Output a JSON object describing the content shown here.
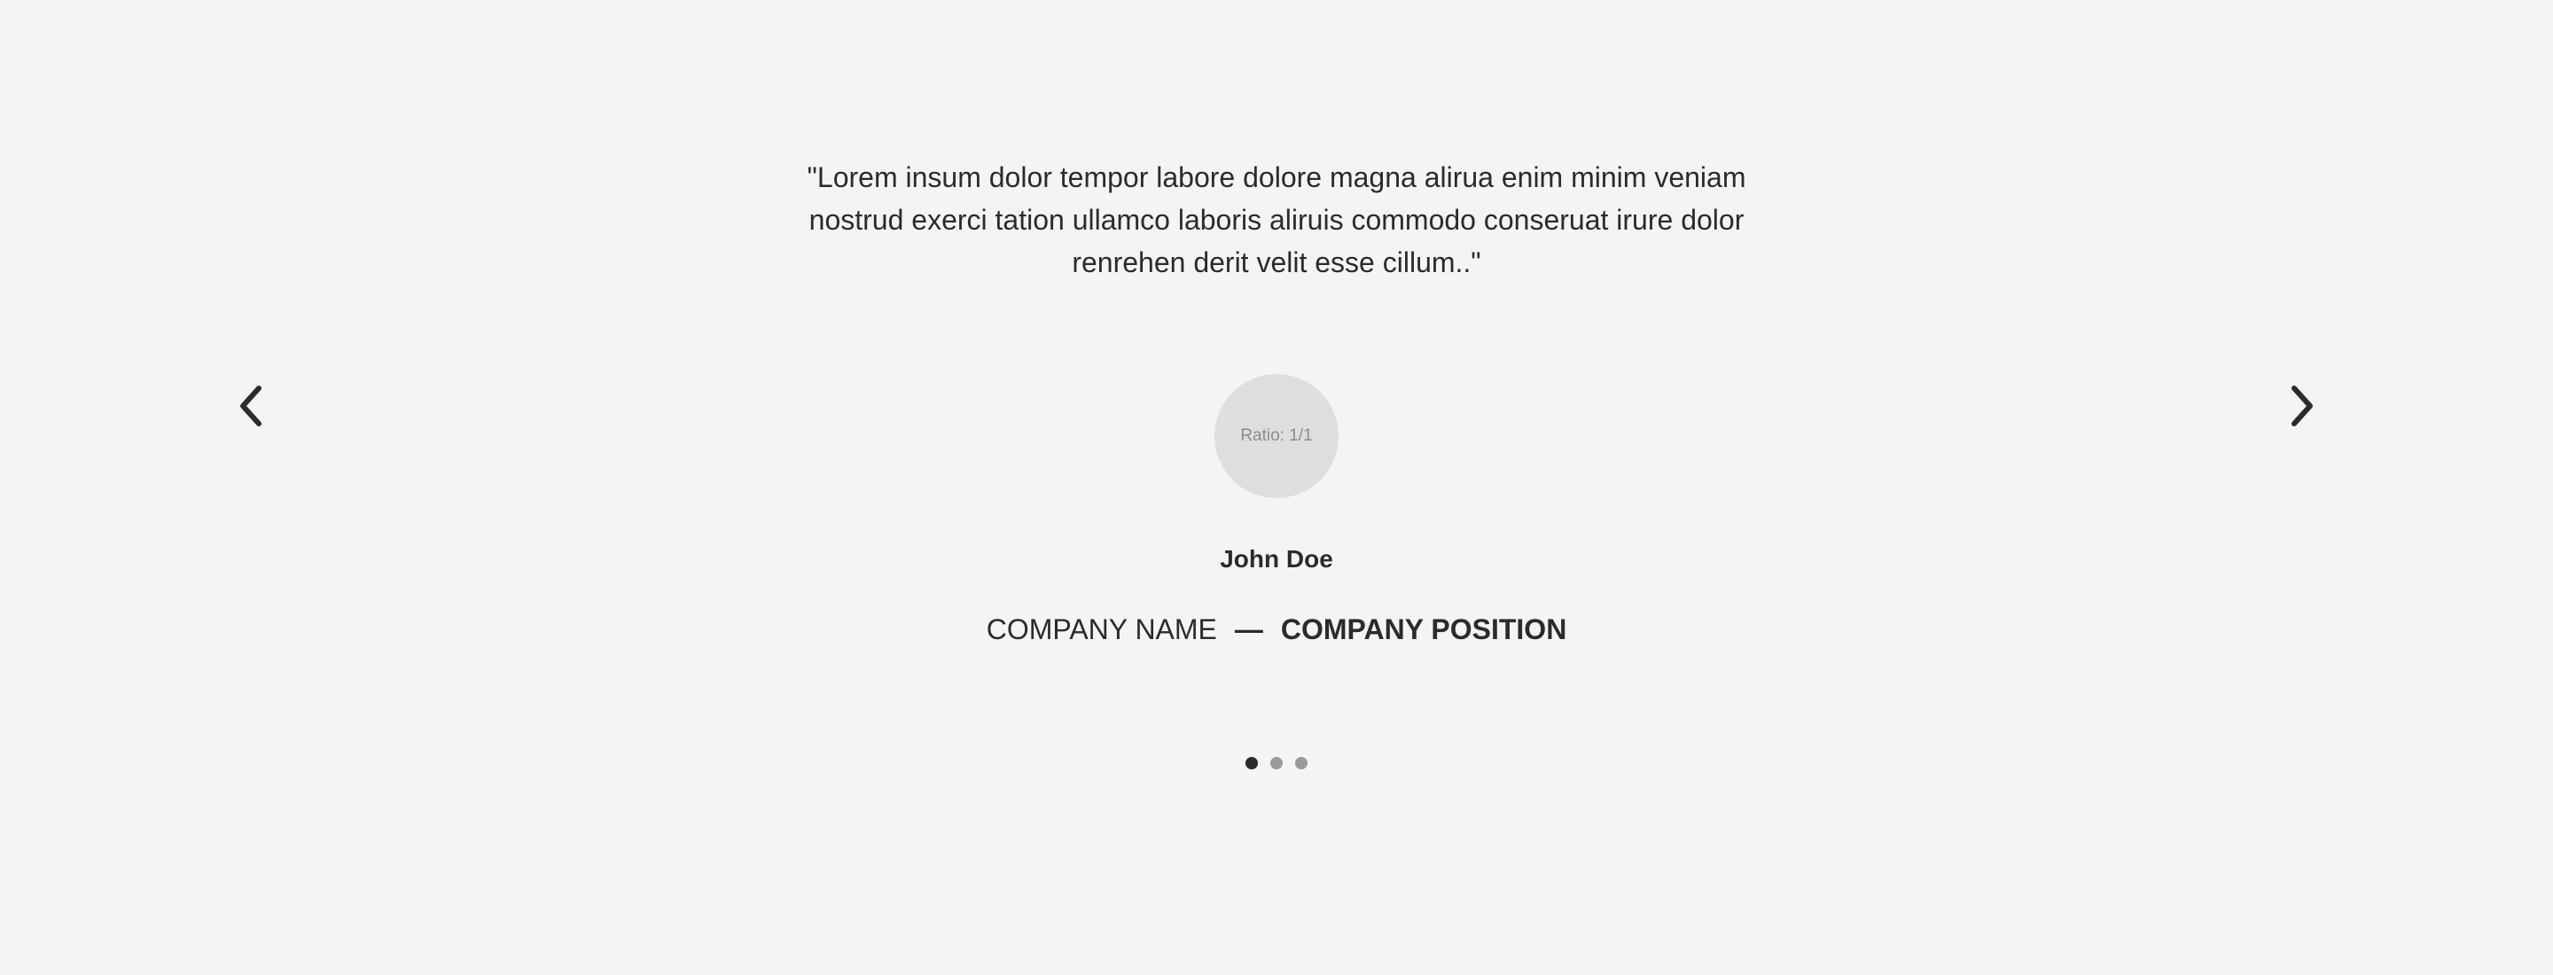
{
  "testimonial": {
    "quote": "\"Lorem insum dolor tempor labore dolore magna alirua enim minim veniam nostrud exerci tation ullamco laboris aliruis commodo conseruat irure dolor renrehen derit velit esse cillum..\"",
    "avatar_placeholder": "Ratio: 1/1",
    "name": "John Doe",
    "company_name": "COMPANY NAME",
    "separator": "—",
    "company_position": "COMPANY POSITION"
  },
  "navigation": {
    "prev_icon": "chevron-left-icon",
    "next_icon": "chevron-right-icon"
  },
  "pagination": {
    "count": 3,
    "active_index": 0
  },
  "colors": {
    "background": "#f4f4f4",
    "text": "#2b2b2b",
    "avatar_bg": "#dedede",
    "dot_active": "#2b2b2b",
    "dot_inactive": "#9a9a9a"
  }
}
